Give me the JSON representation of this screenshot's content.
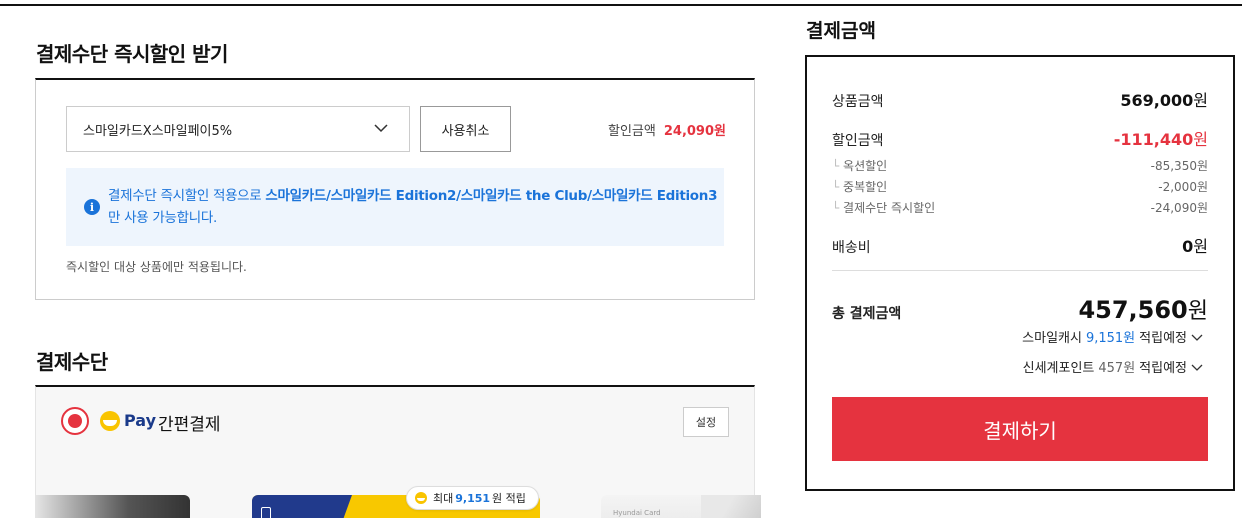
{
  "discount": {
    "title": "결제수단 즉시할인 받기",
    "selected_card": "스마일카드X스마일페이5%",
    "cancel_label": "사용취소",
    "amount_label": "할인금액",
    "amount_value": "24,090원",
    "info_prefix": "결제수단 즉시할인 적용으로 ",
    "info_cards": "스마일카드/스마일카드 Edition2/스마일카드 the Club/스마일카드 Edition3",
    "info_suffix": "만 사용 가능합니다.",
    "note": "즉시할인 대상 상품에만 적용됩니다."
  },
  "payment_method": {
    "title": "결제수단",
    "pay_word": "Pay",
    "pay_label": "간편결제",
    "setting_label": "설정",
    "badge_prefix": "최대",
    "badge_value": "9,151",
    "badge_suffix": "원 적립",
    "card_brand": "Hyundai Card"
  },
  "summary": {
    "title": "결제금액",
    "product_label": "상품금액",
    "product_value": "569,000",
    "discount_label": "할인금액",
    "discount_value": "-111,440",
    "sub_items": [
      {
        "label": "옥션할인",
        "value": "-85,350원"
      },
      {
        "label": "중복할인",
        "value": "-2,000원"
      },
      {
        "label": "결제수단 즉시할인",
        "value": "-24,090원"
      }
    ],
    "shipping_label": "배송비",
    "shipping_value": "0",
    "total_label": "총 결제금액",
    "total_value": "457,560",
    "unit": "원",
    "rewards": [
      {
        "label": "스마일캐시",
        "value": "9,151원",
        "status": "적립예정"
      },
      {
        "label": "신세계포인트",
        "value": "457원",
        "status": "적립예정"
      }
    ],
    "pay_button": "결제하기"
  },
  "colors": {
    "accent_red": "#e5333f",
    "info_blue": "#1a73d9",
    "info_bg": "#eef5fd",
    "pay_yellow": "#f9c400"
  }
}
